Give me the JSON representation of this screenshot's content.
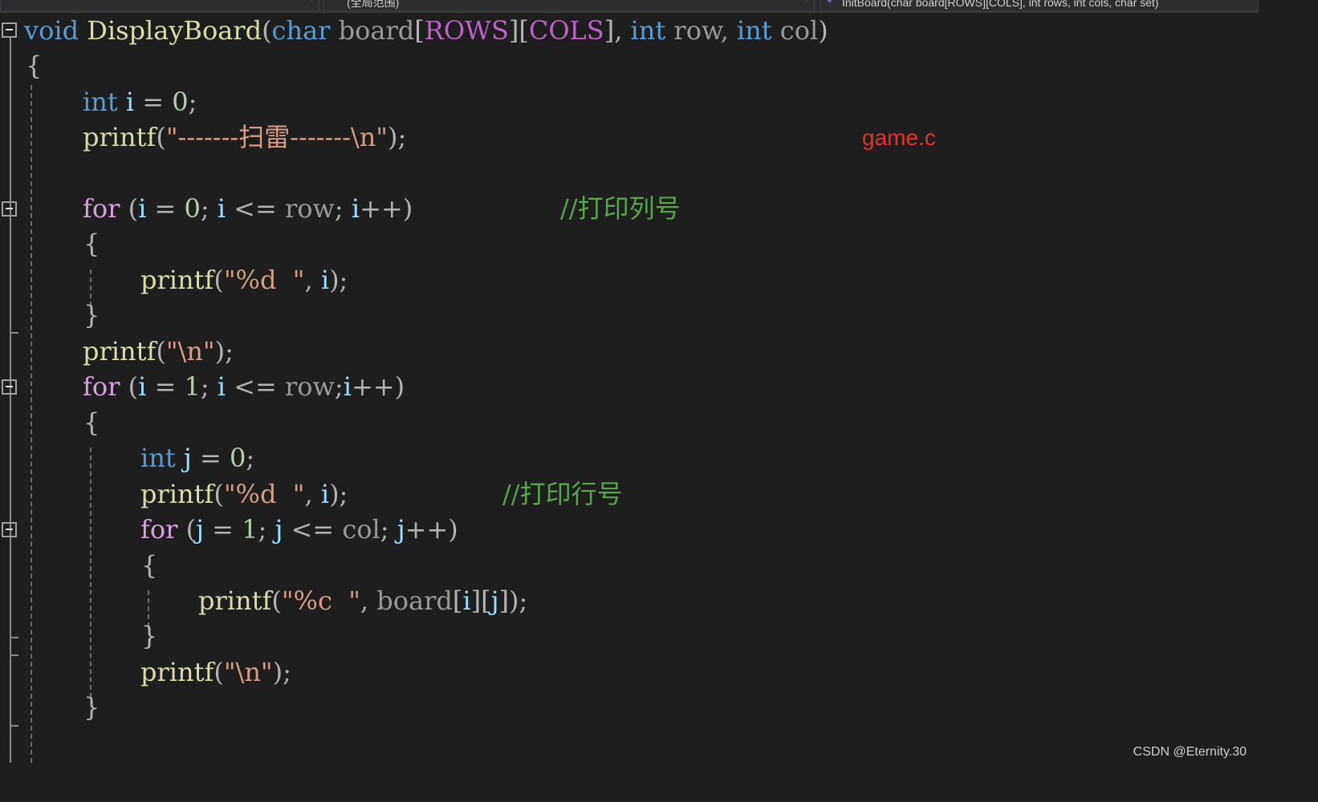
{
  "toolbar": {
    "scope_dropdown": "",
    "scope2_dropdown": "(全局范围)",
    "function_dropdown": "InitBoard(char board[ROWS][COLS], int rows, int cols, char set)"
  },
  "annotation": "game.c",
  "watermark": "CSDN @Eternity.30",
  "code": {
    "l1": {
      "t1": "void",
      "t2": " DisplayBoard",
      "t3": "(",
      "t4": "char",
      "t5": " board",
      "t6": "[",
      "t7": "ROWS",
      "t8": "][",
      "t9": "COLS",
      "t10": "], ",
      "t11": "int",
      "t12": " row, ",
      "t13": "int",
      "t14": " col",
      "t15": ")"
    },
    "l2": {
      "t1": "{"
    },
    "l3": {
      "t1": "int",
      "t2": " i ",
      "t3": "= ",
      "t4": "0",
      "t5": ";"
    },
    "l4": {
      "t1": "printf",
      "t2": "(",
      "t3": "\"-------扫雷-------\\n\"",
      "t4": ");"
    },
    "l5": {
      "t1": "for",
      "t2": " (",
      "t3": "i",
      "t4": " = ",
      "t5": "0",
      "t6": "; ",
      "t7": "i",
      "t8": " <= ",
      "t9": "row",
      "t10": "; ",
      "t11": "i",
      "t12": "++)",
      "t13": "//打印列号"
    },
    "l6": {
      "t1": "{"
    },
    "l7": {
      "t1": "printf",
      "t2": "(",
      "t3": "\"%d  \"",
      "t4": ", ",
      "t5": "i",
      "t6": ");"
    },
    "l8": {
      "t1": "}"
    },
    "l9": {
      "t1": "printf",
      "t2": "(",
      "t3": "\"\\n\"",
      "t4": ");"
    },
    "l10": {
      "t1": "for",
      "t2": " (",
      "t3": "i",
      "t4": " = ",
      "t5": "1",
      "t6": "; ",
      "t7": "i",
      "t8": " <= ",
      "t9": "row",
      "t10": ";",
      "t11": "i",
      "t12": "++)"
    },
    "l11": {
      "t1": "{"
    },
    "l12": {
      "t1": "int",
      "t2": " j ",
      "t3": "= ",
      "t4": "0",
      "t5": ";"
    },
    "l13": {
      "t1": "printf",
      "t2": "(",
      "t3": "\"%d  \"",
      "t4": ", ",
      "t5": "i",
      "t6": ");",
      "t7": "//打印行号"
    },
    "l14": {
      "t1": "for",
      "t2": " (",
      "t3": "j",
      "t4": " = ",
      "t5": "1",
      "t6": "; ",
      "t7": "j",
      "t8": " <= ",
      "t9": "col",
      "t10": "; ",
      "t11": "j",
      "t12": "++)"
    },
    "l15": {
      "t1": "{"
    },
    "l16": {
      "t1": "printf",
      "t2": "(",
      "t3": "\"%c  \"",
      "t4": ", ",
      "t5": "board",
      "t6": "[",
      "t7": "i",
      "t8": "][",
      "t9": "j",
      "t10": "]);"
    },
    "l17": {
      "t1": "}"
    },
    "l18": {
      "t1": "printf",
      "t2": "(",
      "t3": "\"\\n\"",
      "t4": ");"
    },
    "l19": {
      "t1": "}"
    }
  },
  "colors": {
    "background": "#1e1e1e",
    "keyword": "#569cd6",
    "function": "#dcdcaa",
    "string": "#d69d85",
    "number": "#b5cea8",
    "comment": "#57a64a",
    "annotation": "#e8302a"
  },
  "icons": {
    "fold": "collapse-minus-icon",
    "function": "function-cube-icon",
    "dropdown": "chevron-down-icon"
  }
}
